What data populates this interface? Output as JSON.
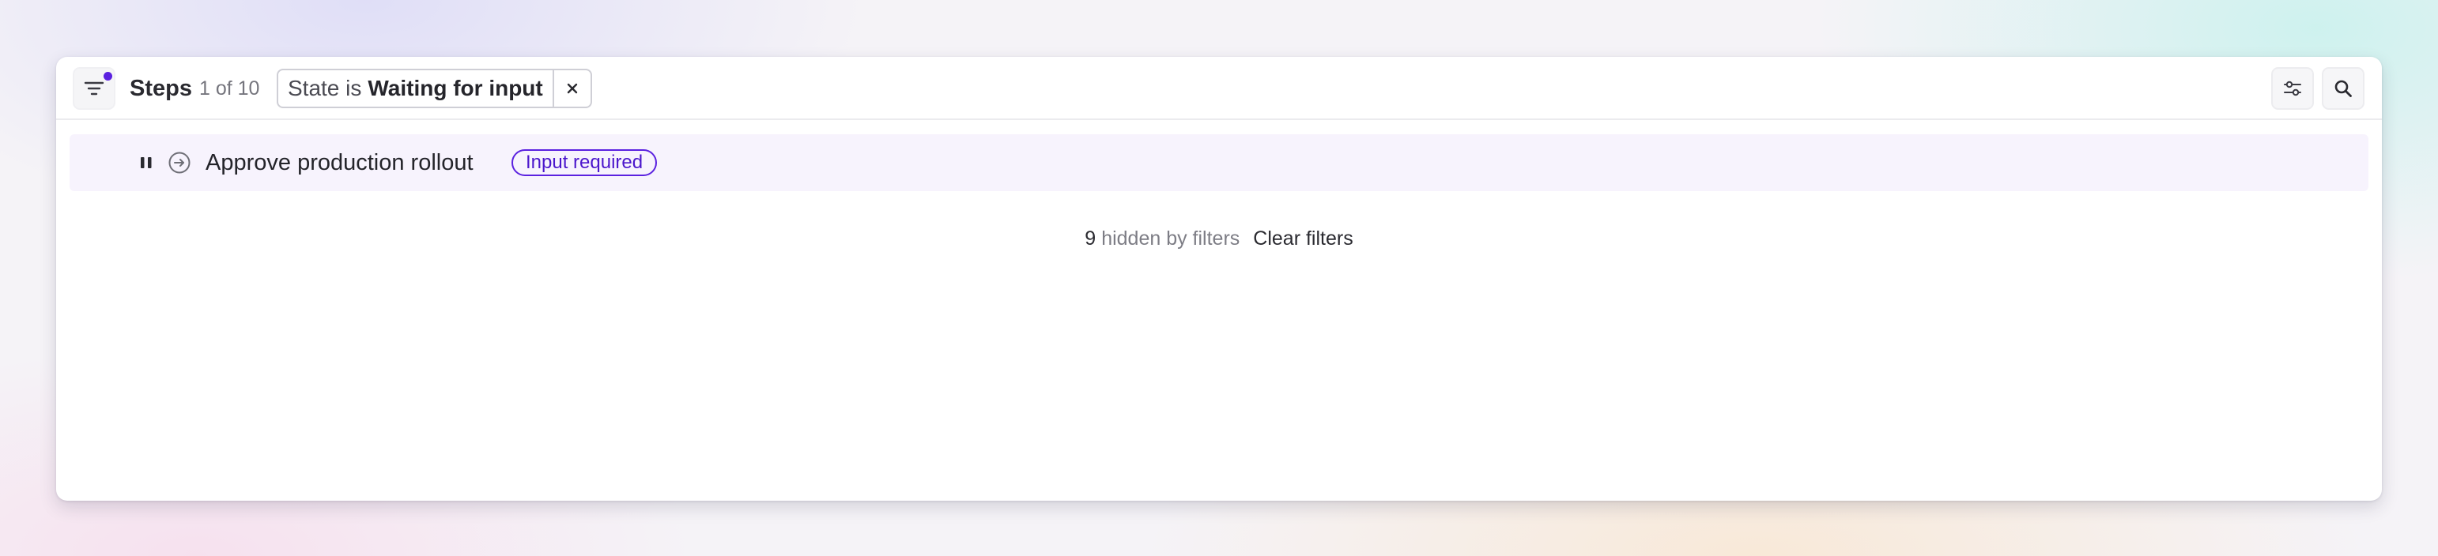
{
  "header": {
    "title": "Steps",
    "count": "1 of 10",
    "filter_chip": {
      "field": "State is",
      "value": "Waiting for input"
    },
    "icons": {
      "filter": "filter-icon",
      "close": "close-icon",
      "display_options": "sliders-icon",
      "search": "search-icon"
    }
  },
  "step": {
    "name": "Approve production rollout",
    "badge": "Input required",
    "icons": {
      "control": "pause-icon",
      "state": "arrow-circle-icon"
    }
  },
  "hidden_summary": {
    "count": "9",
    "text": "hidden by filters",
    "clear_label": "Clear filters"
  },
  "colors": {
    "accent": "#5b21e0",
    "row_highlight": "#f7f3fd",
    "text_primary": "#24242a",
    "text_muted": "#75757d"
  }
}
